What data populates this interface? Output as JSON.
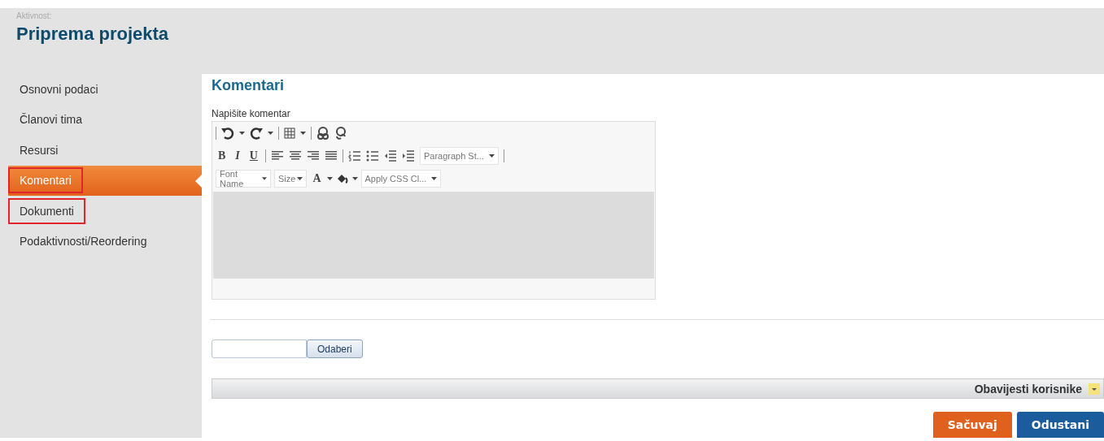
{
  "header": {
    "caption": "Aktivnost:",
    "title": "Priprema projekta"
  },
  "nav": [
    {
      "label": "Osnovni podaci",
      "selected": false,
      "annotated": false
    },
    {
      "label": "Članovi tima",
      "selected": false,
      "annotated": false
    },
    {
      "label": "Resursi",
      "selected": false,
      "annotated": false
    },
    {
      "label": "Komentari",
      "selected": true,
      "annotated": true
    },
    {
      "label": "Dokumenti",
      "selected": false,
      "annotated": true
    },
    {
      "label": "Podaktivnosti/Reordering",
      "selected": false,
      "annotated": false
    }
  ],
  "content": {
    "heading": "Komentari",
    "field_label": "Napišite komentar",
    "editor": {
      "format_buttons": [
        "B",
        "I",
        "U"
      ],
      "paragraph_style": "Paragraph St...",
      "font_name": "Font Name",
      "size": "Size",
      "font_color": "A",
      "css_class": "Apply CSS Cl..."
    },
    "file_button": "Odaberi",
    "notices_bar": "Obavijesti korisnike",
    "buttons": [
      {
        "label": "Sačuvaj",
        "kind": "primary"
      },
      {
        "label": "Odustani",
        "kind": "secondary"
      }
    ]
  }
}
